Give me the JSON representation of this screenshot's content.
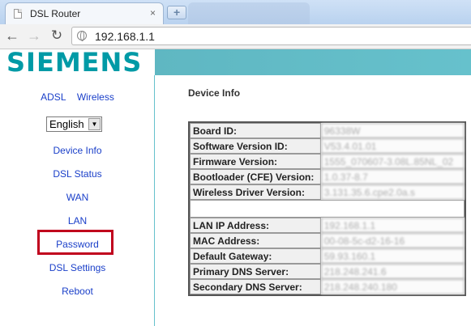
{
  "browser": {
    "tab_title": "DSL Router",
    "tab_close": "×",
    "new_tab": "+",
    "back": "←",
    "forward": "→",
    "reload": "↻",
    "url": "192.168.1.1"
  },
  "header": {
    "logo": "SIEMENS"
  },
  "sidebar": {
    "top_links": [
      "ADSL",
      "Wireless"
    ],
    "language": "English",
    "menu": [
      "Device Info",
      "DSL Status",
      "WAN",
      "LAN",
      "Password",
      "DSL Settings",
      "Reboot"
    ],
    "highlighted_item": "Password",
    "highlight_color": "#c0001d"
  },
  "main": {
    "title": "Device Info",
    "rows": [
      {
        "label": "Board ID:",
        "value": "96338W"
      },
      {
        "label": "Software Version ID:",
        "value": "V53.4.01.01"
      },
      {
        "label": "Firmware Version:",
        "value": "1555_070607-3.08L.85NL_02"
      },
      {
        "label": "Bootloader (CFE) Version:",
        "value": "1.0.37-8.7"
      },
      {
        "label": "Wireless Driver Version:",
        "value": "3.131.35.6.cpe2.0a.s"
      },
      {
        "label": "",
        "value": ""
      },
      {
        "label": "LAN IP Address:",
        "value": "192.168.1.1"
      },
      {
        "label": "MAC Address:",
        "value": "00-08-5c-d2-16-16"
      },
      {
        "label": "Default Gateway:",
        "value": "59.93.160.1"
      },
      {
        "label": "Primary DNS Server:",
        "value": "218.248.241.6"
      },
      {
        "label": "Secondary DNS Server:",
        "value": "218.248.240.180"
      }
    ]
  },
  "colors": {
    "brand": "#009aa6",
    "header_band": "#66c1cc",
    "link": "#1a3fc9"
  }
}
